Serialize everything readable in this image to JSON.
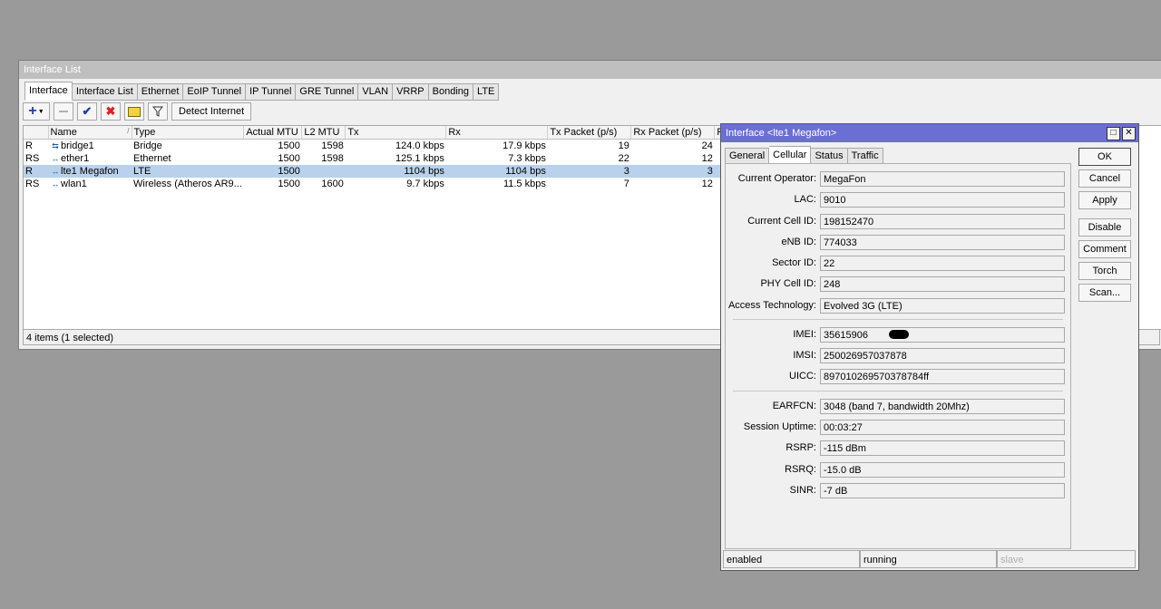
{
  "window": {
    "title": "Interface List",
    "tabs": [
      "Interface",
      "Interface List",
      "Ethernet",
      "EoIP Tunnel",
      "IP Tunnel",
      "GRE Tunnel",
      "VLAN",
      "VRRP",
      "Bonding",
      "LTE"
    ],
    "toolbar": {
      "detect_label": "Detect Internet"
    },
    "columns": [
      "",
      "Name",
      "Type",
      "Actual MTU",
      "L2 MTU",
      "Tx",
      "Rx",
      "Tx Packet (p/s)",
      "Rx Packet (p/s)",
      "FP"
    ],
    "rows": [
      {
        "flag": "R",
        "icon": "bridge-icon",
        "name": "bridge1",
        "type": "Bridge",
        "mtu": "1500",
        "l2mtu": "1598",
        "tx": "124.0 kbps",
        "rx": "17.9 kbps",
        "txp": "19",
        "rxp": "24"
      },
      {
        "flag": "RS",
        "icon": "ethernet-icon",
        "name": "ether1",
        "type": "Ethernet",
        "mtu": "1500",
        "l2mtu": "1598",
        "tx": "125.1 kbps",
        "rx": "7.3 kbps",
        "txp": "22",
        "rxp": "12"
      },
      {
        "flag": "R",
        "icon": "lte-icon",
        "name": "lte1 Megafon",
        "type": "LTE",
        "mtu": "1500",
        "l2mtu": "",
        "tx": "1104 bps",
        "rx": "1104 bps",
        "txp": "3",
        "rxp": "3"
      },
      {
        "flag": "RS",
        "icon": "wireless-icon",
        "name": "wlan1",
        "type": "Wireless (Atheros AR9...",
        "mtu": "1500",
        "l2mtu": "1600",
        "tx": "9.7 kbps",
        "rx": "11.5 kbps",
        "txp": "7",
        "rxp": "12"
      }
    ],
    "status": "4 items (1 selected)"
  },
  "dialog": {
    "title": "Interface <lte1 Megafon>",
    "tabs": [
      "General",
      "Cellular",
      "Status",
      "Traffic"
    ],
    "fields": [
      {
        "label": "Current Operator:",
        "value": "MegaFon"
      },
      {
        "label": "LAC:",
        "value": "9010"
      },
      {
        "label": "Current Cell ID:",
        "value": "198152470"
      },
      {
        "label": "eNB ID:",
        "value": "774033"
      },
      {
        "label": "Sector ID:",
        "value": "22"
      },
      {
        "label": "PHY Cell ID:",
        "value": "248"
      },
      {
        "label": "Access Technology:",
        "value": "Evolved 3G (LTE)"
      },
      {
        "label": "IMEI:",
        "value": "35615906"
      },
      {
        "label": "IMSI:",
        "value": "250026957037878"
      },
      {
        "label": "UICC:",
        "value": "897010269570378784ff"
      },
      {
        "label": "EARFCN:",
        "value": "3048 (band 7, bandwidth 20Mhz)"
      },
      {
        "label": "Session Uptime:",
        "value": "00:03:27"
      },
      {
        "label": "RSRP:",
        "value": "-115 dBm"
      },
      {
        "label": "RSRQ:",
        "value": "-15.0 dB"
      },
      {
        "label": "SINR:",
        "value": "-7 dB"
      }
    ],
    "buttons": [
      "OK",
      "Cancel",
      "Apply",
      "Disable",
      "Comment",
      "Torch",
      "Scan..."
    ],
    "status": [
      "enabled",
      "running",
      "slave"
    ]
  }
}
